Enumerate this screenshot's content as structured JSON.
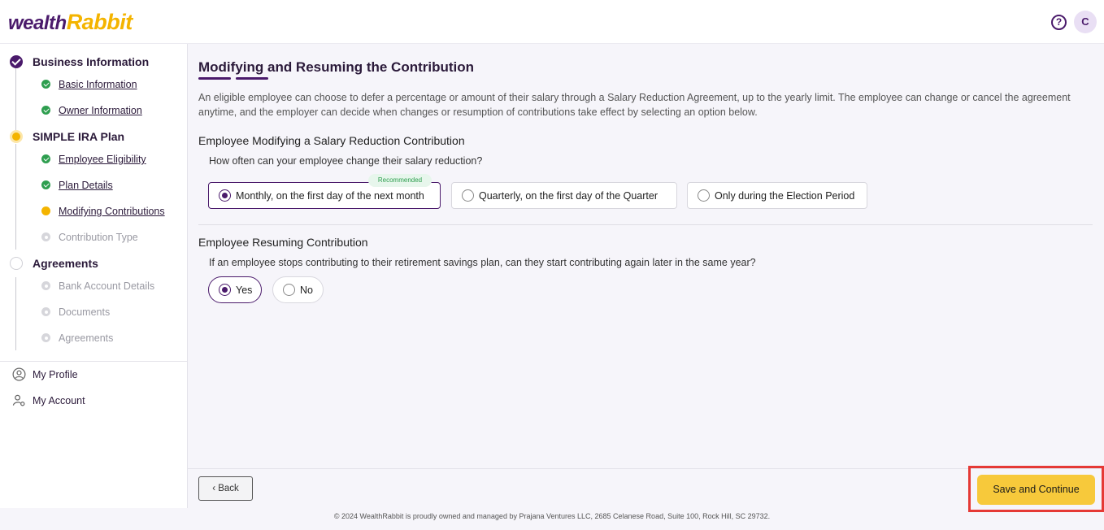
{
  "header": {
    "logo_part1": "wealth",
    "logo_part2": "Rabbit",
    "help_glyph": "?",
    "avatar_initial": "C"
  },
  "sidebar": {
    "sections": [
      {
        "label": "Business Information",
        "state": "done"
      },
      {
        "label": "SIMPLE IRA Plan",
        "state": "active"
      },
      {
        "label": "Agreements",
        "state": "pending"
      }
    ],
    "items": [
      {
        "label": "Basic Information",
        "state": "done"
      },
      {
        "label": "Owner Information",
        "state": "done"
      },
      {
        "label": "Employee Eligibility",
        "state": "done"
      },
      {
        "label": "Plan Details",
        "state": "done"
      },
      {
        "label": "Modifying Contributions",
        "state": "current"
      },
      {
        "label": "Contribution Type",
        "state": "disabled"
      },
      {
        "label": "Bank Account Details",
        "state": "disabled"
      },
      {
        "label": "Documents",
        "state": "disabled"
      },
      {
        "label": "Agreements",
        "state": "disabled"
      }
    ],
    "account": [
      {
        "label": "My Profile",
        "icon": "user-circle-icon"
      },
      {
        "label": "My Account",
        "icon": "user-settings-icon"
      }
    ]
  },
  "main": {
    "title": "Modifying and Resuming the Contribution",
    "intro": "An eligible employee can choose to defer a percentage or amount of their salary through a Salary Reduction Agreement, up to the yearly limit. The employee can change or cancel the agreement anytime, and the employer can decide when changes or resumption of contributions take effect by selecting an option below.",
    "modify": {
      "heading": "Employee Modifying a Salary Reduction Contribution",
      "question": "How often can your employee change their salary reduction?",
      "recommended_badge": "Recommended",
      "options": [
        {
          "label": "Monthly, on the first day of the next month",
          "selected": true
        },
        {
          "label": "Quarterly, on the first day of the Quarter",
          "selected": false
        },
        {
          "label": "Only during the Election Period",
          "selected": false
        }
      ]
    },
    "resume": {
      "heading": "Employee Resuming Contribution",
      "question": "If an employee stops contributing to their retirement savings plan, can they start contributing again later in the same year?",
      "options": [
        {
          "label": "Yes",
          "selected": true
        },
        {
          "label": "No",
          "selected": false
        }
      ]
    }
  },
  "footer": {
    "back_label": "Back",
    "back_icon": "chevron-left-icon",
    "save_label": "Save and Continue",
    "copyright": "© 2024 WealthRabbit is proudly owned and managed by Prajana Ventures LLC, 2685 Celanese Road, Suite 100, Rock Hill, SC 29732."
  },
  "colors": {
    "brand": "#4a1a6b",
    "accent": "#f7c93b",
    "success": "#2e9e4f",
    "highlight": "#e53935"
  }
}
